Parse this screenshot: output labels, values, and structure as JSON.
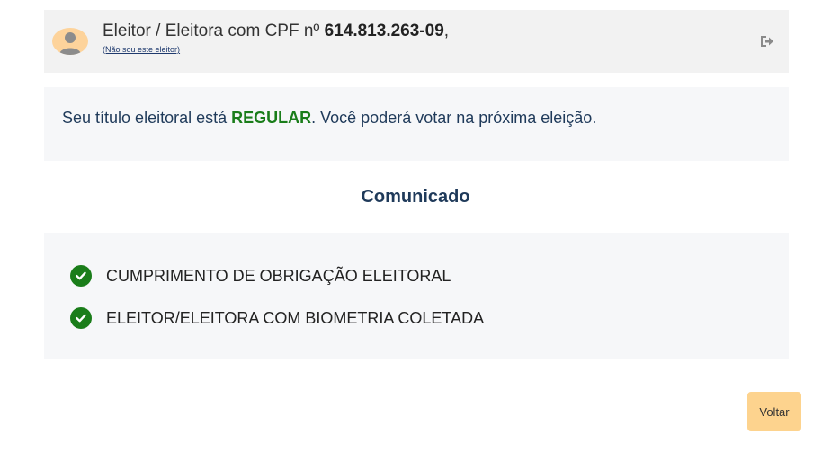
{
  "user_bar": {
    "prefix": "Eleitor / Eleitora com CPF nº ",
    "cpf": "614.813.263-09",
    "suffix": ",",
    "not_me_link": "(Não sou este eleitor)",
    "avatar_icon": "user-avatar-icon",
    "logout_icon": "sign-out-icon"
  },
  "status": {
    "prefix": "Seu título eleitoral está ",
    "value": "REGULAR",
    "suffix": ". Você poderá votar na próxima eleição.",
    "status_color": "#1a7d1a"
  },
  "notice": {
    "title": "Comunicado",
    "items": [
      {
        "label": "CUMPRIMENTO DE OBRIGAÇÃO ELEITORAL",
        "icon": "check-circle-icon"
      },
      {
        "label": "ELEITOR/ELEITORA COM BIOMETRIA COLETADA",
        "icon": "check-circle-icon"
      }
    ]
  },
  "actions": {
    "back_label": "Voltar",
    "back_color": "#fdd38e"
  }
}
